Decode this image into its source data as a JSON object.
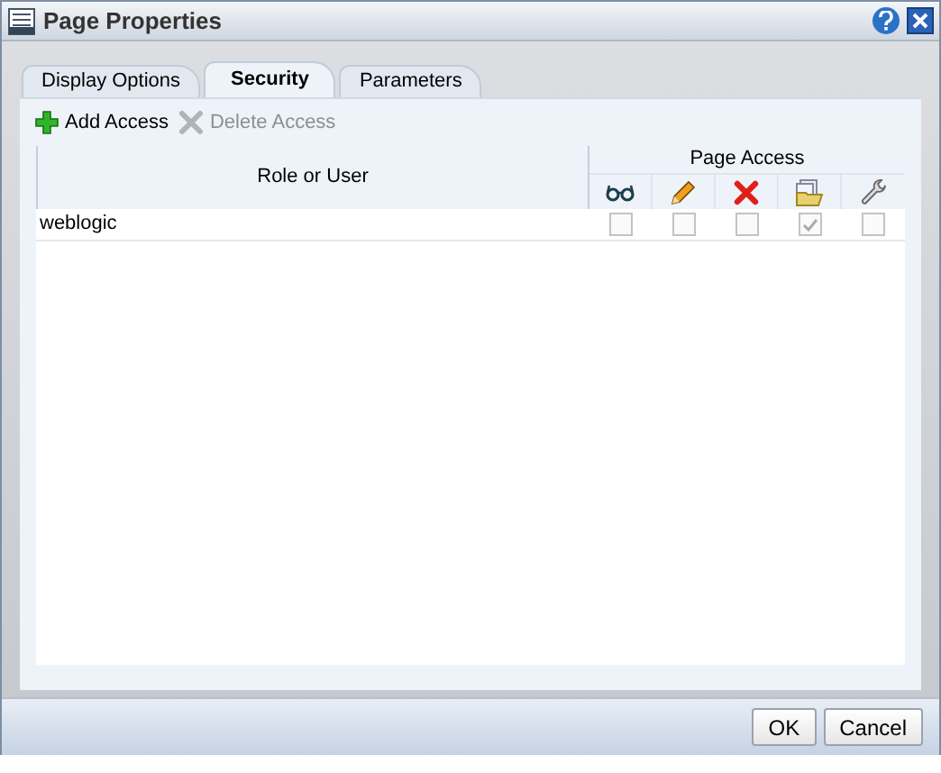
{
  "window": {
    "title": "Page Properties"
  },
  "tabs": [
    {
      "label": "Display Options",
      "selected": false
    },
    {
      "label": "Security",
      "selected": true
    },
    {
      "label": "Parameters",
      "selected": false
    }
  ],
  "toolbar": [
    {
      "label": "Add Access",
      "kind": "add",
      "disabled": false
    },
    {
      "label": "Delete Access",
      "kind": "delete",
      "disabled": true
    }
  ],
  "table": {
    "role_column": "Role or User",
    "group_column": "Page Access",
    "permission_columns": [
      {
        "kind": "view"
      },
      {
        "kind": "edit"
      },
      {
        "kind": "delete"
      },
      {
        "kind": "manage"
      },
      {
        "kind": "customize"
      }
    ],
    "rows": [
      {
        "name": "weblogic",
        "permissions": [
          {
            "checked": false
          },
          {
            "checked": false
          },
          {
            "checked": false
          },
          {
            "checked": true
          },
          {
            "checked": false
          }
        ]
      }
    ]
  },
  "buttons": [
    "OK",
    "Cancel"
  ]
}
